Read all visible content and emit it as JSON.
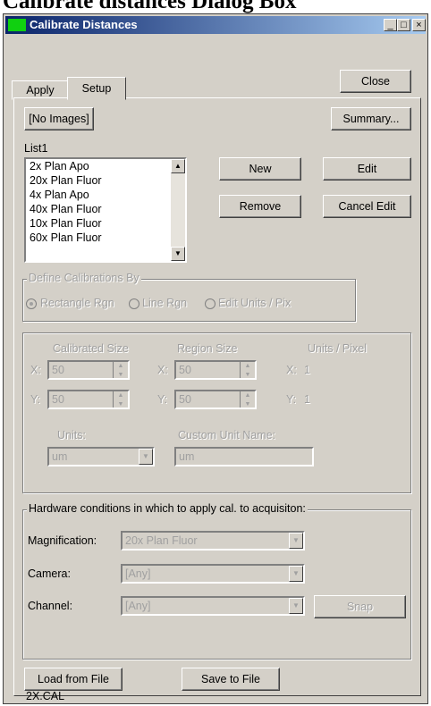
{
  "heading": "Calibrate distances Dialog Box",
  "window": {
    "title": "Calibrate Distances",
    "minimize": "_",
    "maximize": "□",
    "close": "×"
  },
  "tabs": [
    {
      "label": "Apply"
    },
    {
      "label": "Setup"
    }
  ],
  "buttons": {
    "close": "Close",
    "no_images": "[No Images]",
    "summary": "Summary...",
    "new": "New",
    "edit": "Edit",
    "remove": "Remove",
    "cancel_edit": "Cancel Edit",
    "snap": "Snap",
    "load_file": "Load from File",
    "save_file": "Save to File"
  },
  "list": {
    "label": "List1",
    "items": [
      "2x Plan Apo",
      "20x Plan Fluor",
      "4x Plan Apo",
      "40x Plan Fluor",
      "10x Plan Fluor",
      "60x Plan Fluor"
    ]
  },
  "define": {
    "legend": "Define Calibrations By",
    "options": [
      "Rectangle Rgn",
      "Line Rgn",
      "Edit Units / Pix"
    ],
    "selected": "Rectangle Rgn"
  },
  "calib": {
    "calibrated_size": "Calibrated Size",
    "region_size": "Region Size",
    "units_per_pixel": "Units / Pixel",
    "x_label": "X:",
    "y_label": "Y:",
    "cal_x": "50",
    "cal_y": "50",
    "reg_x": "50",
    "reg_y": "50",
    "upp_x": "1",
    "upp_y": "1",
    "units_label": "Units:",
    "units_value": "um",
    "custom_label": "Custom Unit Name:",
    "custom_value": "um"
  },
  "hardware": {
    "legend": "Hardware conditions in which to apply cal. to acquisiton:",
    "magnification_label": "Magnification:",
    "magnification_value": "20x Plan Fluor",
    "camera_label": "Camera:",
    "camera_value": "[Any]",
    "channel_label": "Channel:",
    "channel_value": "[Any]"
  },
  "file_name": "2X.CAL"
}
